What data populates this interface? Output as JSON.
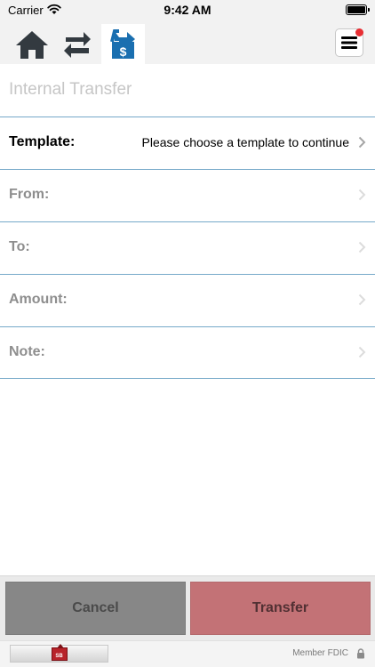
{
  "status_bar": {
    "carrier": "Carrier",
    "time": "9:42 AM"
  },
  "nav": {
    "icons": [
      "home-icon",
      "swap-arrows-icon",
      "transfer-dollar-icon",
      "hamburger-menu-icon"
    ],
    "active_tab": "transfer",
    "accent_color": "#1a6fb0",
    "icon_color": "#333a40",
    "notification_color": "#e82e33"
  },
  "form": {
    "title": "Internal Transfer",
    "rows": [
      {
        "label": "Template:",
        "value": "Please choose a template to continue"
      },
      {
        "label": "From:",
        "value": ""
      },
      {
        "label": "To:",
        "value": ""
      },
      {
        "label": "Amount:",
        "value": ""
      },
      {
        "label": "Note:",
        "value": ""
      }
    ],
    "divider_color": "#76a9c9"
  },
  "actions": {
    "cancel_label": "Cancel",
    "transfer_label": "Transfer",
    "cancel_color": "#878787",
    "transfer_color": "#c37276"
  },
  "footer": {
    "logo_text": "SB",
    "member_text": "Member FDIC",
    "lock_icon": "lock-icon"
  }
}
